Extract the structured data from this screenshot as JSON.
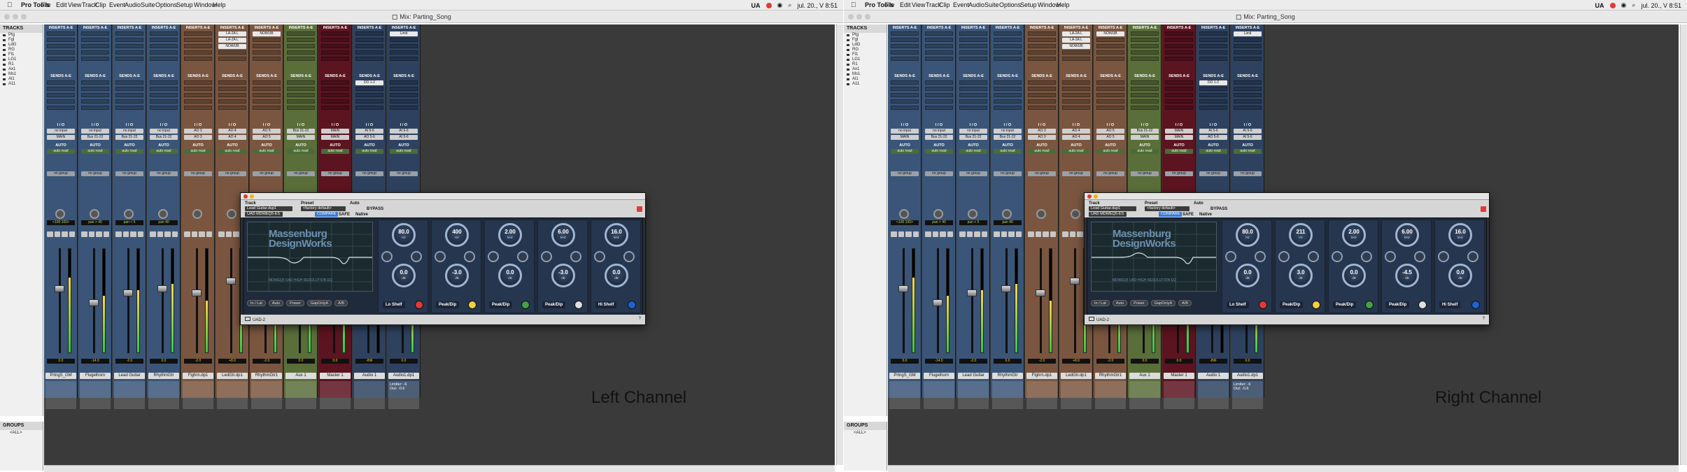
{
  "app_menu": {
    "app_name": "Pro Tools",
    "items": [
      "File",
      "Edit",
      "View",
      "Track",
      "Clip",
      "Event",
      "AudioSuite",
      "Options",
      "Setup",
      "Window",
      "Help"
    ],
    "status_text": "jul. 20., V 8:51",
    "ua_label": "UA"
  },
  "window_title": "Mix: Parting_Song",
  "tracks_header": "TRACKS",
  "tracks_list": [
    "Ptg",
    "Fgl",
    "LdG",
    "RG",
    "Fl1",
    "LG1",
    "R1",
    "Ax1",
    "Ms1",
    "Al1",
    "A11"
  ],
  "groups_header": "GROUPS",
  "groups_row": "<ALL>",
  "sections": {
    "inserts": "INSERTS A-E",
    "sends": "SENDS A-E",
    "io": "I / O",
    "auto": "AUTO",
    "auto_mode": "auto read",
    "group": "no group"
  },
  "strips": [
    {
      "name": "PrtngS_GM",
      "input": "no input",
      "output": "MAIN",
      "pan": "<100 100>",
      "vol": "0.0",
      "color": "#3a5578",
      "inserts": [],
      "sends": [],
      "meter": 0.72,
      "fader": 0.62,
      "comment": ""
    },
    {
      "name": "Flugelhorn",
      "input": "no input",
      "output": "Bus 21-22",
      "pan": "pan > 40",
      "vol": "-14.0",
      "color": "#3a5578",
      "inserts": [],
      "sends": [],
      "meter": 0.55,
      "fader": 0.48,
      "comment": ""
    },
    {
      "name": "Lead Guitar",
      "input": "no input",
      "output": "Bus 21-22",
      "pan": "pan < 5",
      "vol": "-2.0",
      "color": "#3a5578",
      "inserts": [],
      "sends": [],
      "meter": 0.6,
      "fader": 0.58,
      "comment": ""
    },
    {
      "name": "RhythmGtr",
      "input": "no input",
      "output": "Bus 21-22",
      "pan": "pan 40",
      "vol": "0.0",
      "color": "#3a5578",
      "inserts": [],
      "sends": [],
      "meter": 0.66,
      "fader": 0.62,
      "comment": ""
    },
    {
      "name": "Flghrn.dp1",
      "input": "AO 3",
      "output": "AO 3",
      "pan": "",
      "vol": "-2.0",
      "color": "#7a5640",
      "inserts": [],
      "sends": [],
      "meter": 0.5,
      "fader": 0.58,
      "comment": ""
    },
    {
      "name": "LedGtr.dp1",
      "input": "AO 4",
      "output": "AO 4",
      "pan": "",
      "vol": "+8.0",
      "color": "#7a5640",
      "inserts": [
        "LA-2A L",
        "LA-2A L",
        "NOWUB"
      ],
      "sends": [],
      "meter": 0.62,
      "fader": 0.7,
      "comment": ""
    },
    {
      "name": "RhythmGtr1",
      "input": "AO 5",
      "output": "AO 5",
      "pan": "",
      "vol": "-2.0",
      "color": "#7a5640",
      "inserts": [
        "NOWUB"
      ],
      "sends": [],
      "meter": 0.58,
      "fader": 0.58,
      "comment": ""
    },
    {
      "name": "Aux 1",
      "input": "Bus 21-22",
      "output": "MAIN",
      "pan": "",
      "vol": "0.0",
      "color": "#5a6e3a",
      "inserts": [],
      "sends": [],
      "meter": 0.64,
      "fader": 0.62,
      "comment": ""
    },
    {
      "name": "Master 1",
      "input": "MAIN",
      "output": "MAIN",
      "pan": "",
      "vol": "0.0",
      "color": "#5c1420",
      "inserts": [],
      "sends": [],
      "meter": 0.7,
      "fader": 0.62,
      "comment": ""
    },
    {
      "name": "Audio 1",
      "input": "AI 5-6",
      "output": "AO 5-6",
      "pan": "",
      "vol": "-INF",
      "color": "#2e4260",
      "inserts": [],
      "sends": [
        "DO 1-2"
      ],
      "meter": 0.0,
      "fader": 0.62,
      "comment": ""
    },
    {
      "name": "Audio1.dp1",
      "input": "AI 5-6",
      "output": "AI 5-6",
      "pan": "",
      "vol": "0.0",
      "color": "#2e4260",
      "inserts": [
        "Limit"
      ],
      "sends": [],
      "meter": 0.4,
      "fader": 0.62,
      "comment": "Limiter: -6\nOut: -0.6"
    }
  ],
  "plugin": {
    "track_label": "Track",
    "preset_label": "Preset",
    "auto_label": "Auto",
    "track_dd": "Lead Guitar.dup1",
    "preset_dd": "<factory default>",
    "plugin_dd": "UAD MDWEQ5-ES",
    "compare": "COMPARE",
    "safe": "SAFE",
    "bypass": "BYPASS",
    "native": "Native",
    "brand1": "Massenburg",
    "brand2": "DesignWorks",
    "brand_sub": "MDWEQ5 UAD HIGH RESOLUTION EQ",
    "bottom_btns": [
      "In / Lat",
      "Auto",
      "Power",
      "GapOnlyA",
      "A/B"
    ],
    "footer": "UAD-2",
    "footer_help": "?"
  },
  "plugins": [
    {
      "caption": "Left Channel",
      "bands": [
        {
          "label": "Lo Shelf",
          "freq": "80.0",
          "freq_unit": "Hz",
          "gain": "0.0",
          "gain_unit": "dB",
          "led": "#e53935"
        },
        {
          "label": "Peak/Dip",
          "freq": "400",
          "freq_unit": "Hz",
          "gain": "-3.0",
          "gain_unit": "dB",
          "led": "#f4d03f"
        },
        {
          "label": "Peak/Dip",
          "freq": "2.00",
          "freq_unit": "kHz",
          "gain": "0.0",
          "gain_unit": "dB",
          "led": "#43a047"
        },
        {
          "label": "Peak/Dip",
          "freq": "6.00",
          "freq_unit": "kHz",
          "gain": "-3.0",
          "gain_unit": "dB",
          "led": "#e0e0e0"
        },
        {
          "label": "Hi Shelf",
          "freq": "16.0",
          "freq_unit": "kHz",
          "gain": "0.0",
          "gain_unit": "dB",
          "led": "#1e63d6"
        }
      ]
    },
    {
      "caption": "Right Channel",
      "bands": [
        {
          "label": "Lo Shelf",
          "freq": "80.0",
          "freq_unit": "Hz",
          "gain": "0.0",
          "gain_unit": "dB",
          "led": "#e53935"
        },
        {
          "label": "Peak/Dip",
          "freq": "211",
          "freq_unit": "Hz",
          "gain": "3.0",
          "gain_unit": "dB",
          "led": "#f4d03f"
        },
        {
          "label": "Peak/Dip",
          "freq": "2.00",
          "freq_unit": "kHz",
          "gain": "0.0",
          "gain_unit": "dB",
          "led": "#43a047"
        },
        {
          "label": "Peak/Dip",
          "freq": "6.00",
          "freq_unit": "kHz",
          "gain": "-4.5",
          "gain_unit": "dB",
          "led": "#e0e0e0"
        },
        {
          "label": "Hi Shelf",
          "freq": "16.0",
          "freq_unit": "kHz",
          "gain": "0.0",
          "gain_unit": "dB",
          "led": "#1e63d6"
        }
      ]
    }
  ]
}
